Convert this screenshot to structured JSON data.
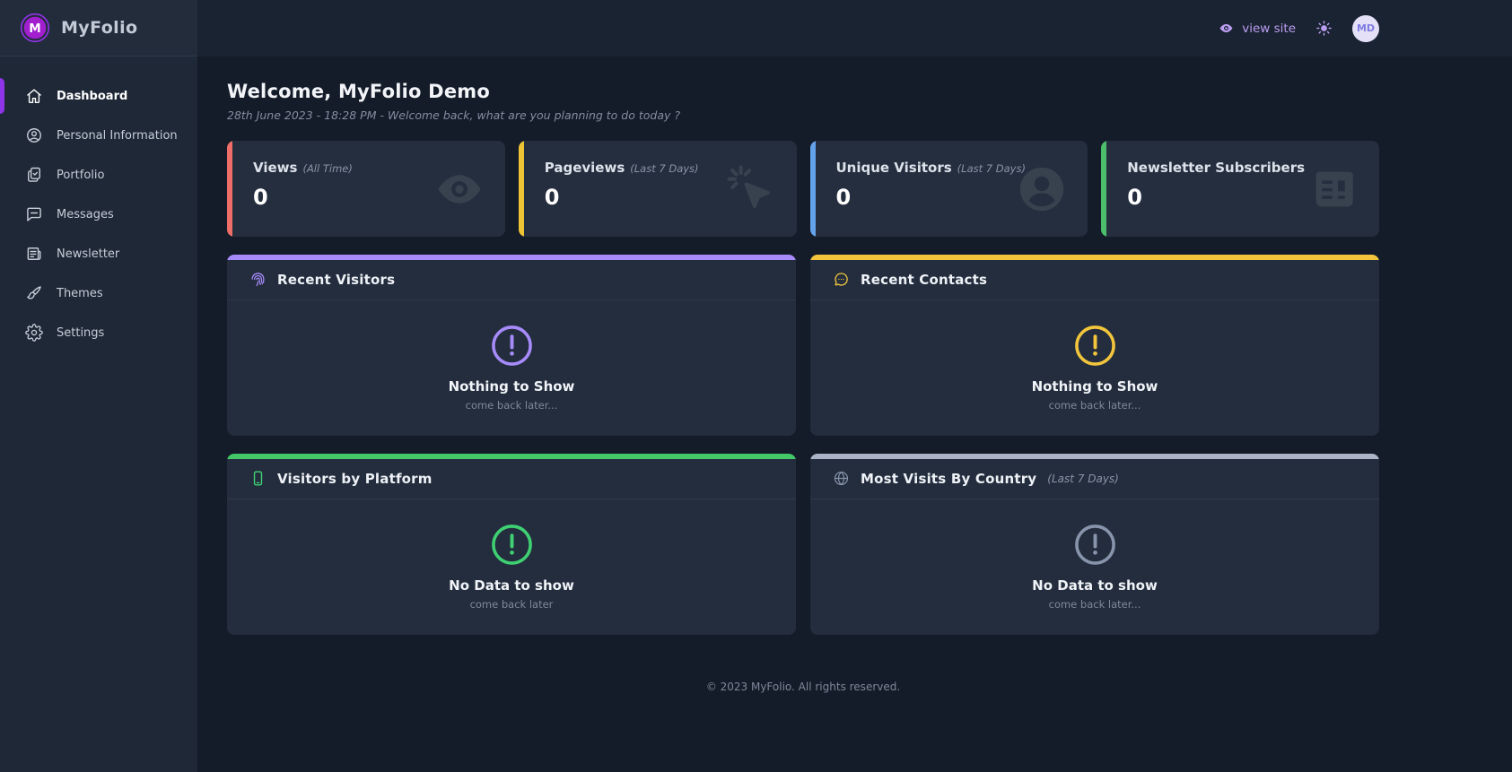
{
  "brand": {
    "name": "MyFolio",
    "logo_letter": "M"
  },
  "topbar": {
    "view_site": "view site",
    "avatar_initials": "MD"
  },
  "sidebar": {
    "items": [
      {
        "label": "Dashboard",
        "icon": "home-icon",
        "active": true
      },
      {
        "label": "Personal Information",
        "icon": "person-circle-icon",
        "active": false
      },
      {
        "label": "Portfolio",
        "icon": "clipboard-icon",
        "active": false
      },
      {
        "label": "Messages",
        "icon": "chat-bubble-icon",
        "active": false
      },
      {
        "label": "Newsletter",
        "icon": "newspaper-icon",
        "active": false
      },
      {
        "label": "Themes",
        "icon": "paintbrush-icon",
        "active": false
      },
      {
        "label": "Settings",
        "icon": "gear-icon",
        "active": false
      }
    ]
  },
  "welcome": {
    "title": "Welcome, MyFolio Demo",
    "subtitle": "28th June 2023 - 18:28 PM - Welcome back, what are you planning to do today ?"
  },
  "stats": [
    {
      "label": "Views",
      "period": "(All Time)",
      "value": "0",
      "accent": "#ee6e68",
      "icon": "eye-icon"
    },
    {
      "label": "Pageviews",
      "period": "(Last 7 Days)",
      "value": "0",
      "accent": "#eec435",
      "icon": "cursor-click-icon"
    },
    {
      "label": "Unique Visitors",
      "period": "(Last 7 Days)",
      "value": "0",
      "accent": "#64a3ea",
      "icon": "person-icon"
    },
    {
      "label": "Newsletter Subscribers",
      "period": "",
      "value": "0",
      "accent": "#4cbd6b",
      "icon": "newspaper-icon"
    }
  ],
  "panels": [
    {
      "title": "Recent Visitors",
      "period": "",
      "accent": "#a78bfa",
      "icon_color": "#a78bfa",
      "icon": "fingerprint-icon",
      "empty_title": "Nothing to Show",
      "empty_subtitle": "come back later..."
    },
    {
      "title": "Recent Contacts",
      "period": "",
      "accent": "#f2c53d",
      "icon_color": "#f2c53d",
      "icon": "chat-bubble-icon",
      "empty_title": "Nothing to Show",
      "empty_subtitle": "come back later..."
    },
    {
      "title": "Visitors by Platform",
      "period": "",
      "accent": "#43c767",
      "icon_color": "#3fd073",
      "icon": "smartphone-icon",
      "empty_title": "No Data to show",
      "empty_subtitle": "come back later"
    },
    {
      "title": "Most Visits By Country",
      "period": "(Last 7 Days)",
      "accent": "#a9b4c6",
      "icon_color": "#8794ab",
      "icon": "globe-icon",
      "empty_title": "No Data to show",
      "empty_subtitle": "come back later..."
    }
  ],
  "footer": {
    "copyright": "© 2023 MyFolio. All rights reserved."
  },
  "colors": {
    "accent_purple": "#8f34e8",
    "logo_fill": "#a21fd0",
    "background": "#141b29",
    "sidebar": "#1e2836",
    "card": "#242e3e",
    "link_purple": "#bb9df0"
  }
}
